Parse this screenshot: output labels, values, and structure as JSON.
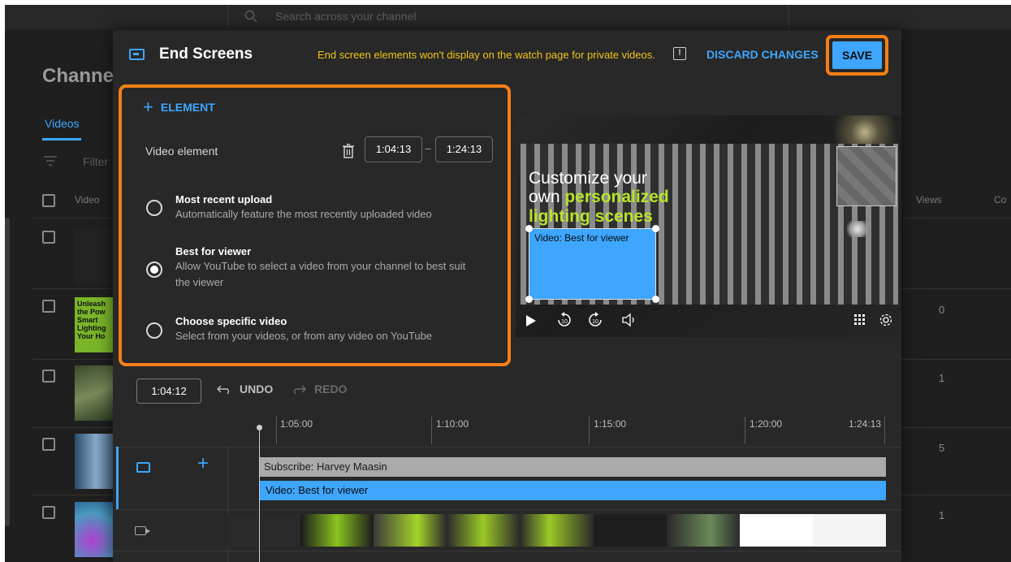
{
  "background": {
    "search_placeholder": "Search across your channel",
    "title": "Channel",
    "tab": "Videos",
    "filter": "Filter",
    "columns": {
      "video": "Video",
      "views": "Views",
      "comments": "Co"
    },
    "rows": [
      {
        "views": ""
      },
      {
        "views": "0"
      },
      {
        "views": "1"
      },
      {
        "views": "5"
      },
      {
        "views": "1"
      }
    ],
    "thumb2_text": "Unleash the Pow Smart Lighting Your Ho"
  },
  "modal": {
    "title": "End Screens",
    "note": "End screen elements won't display on the watch page for private videos.",
    "discard_label": "DISCARD CHANGES",
    "save_label": "SAVE"
  },
  "panel": {
    "add_element_label": "ELEMENT",
    "element_label": "Video element",
    "start_time": "1:04:13",
    "end_time": "1:24:13",
    "options": [
      {
        "title": "Most recent upload",
        "desc": [
          "Automatically feature the most recently uploaded video"
        ],
        "selected": false
      },
      {
        "title": "Best for viewer",
        "desc": [
          "Allow YouTube to select a video from your channel to best suit",
          "the viewer"
        ],
        "selected": true
      },
      {
        "title": "Choose specific video",
        "desc": [
          "Select from your videos, or from any video on YouTube"
        ],
        "selected": false
      }
    ]
  },
  "preview": {
    "video_text_line1": "Customize your",
    "video_text_line2a": "own ",
    "video_text_line2b": "personalized",
    "video_text_line3": "lighting scenes",
    "element_label": "Video: Best for viewer"
  },
  "timeline": {
    "current_time": "1:04:12",
    "undo_label": "UNDO",
    "redo_label": "REDO",
    "ticks": [
      "1:05:00",
      "1:10:00",
      "1:15:00",
      "1:20:00",
      "1:24:13"
    ],
    "subscribe_bar": "Subscribe: Harvey Maasin",
    "video_bar": "Video: Best for viewer"
  },
  "colors": {
    "accent": "#3ea6ff",
    "highlight": "#f57f17",
    "warning": "#f0c419",
    "green_text": "#b8e42a"
  }
}
